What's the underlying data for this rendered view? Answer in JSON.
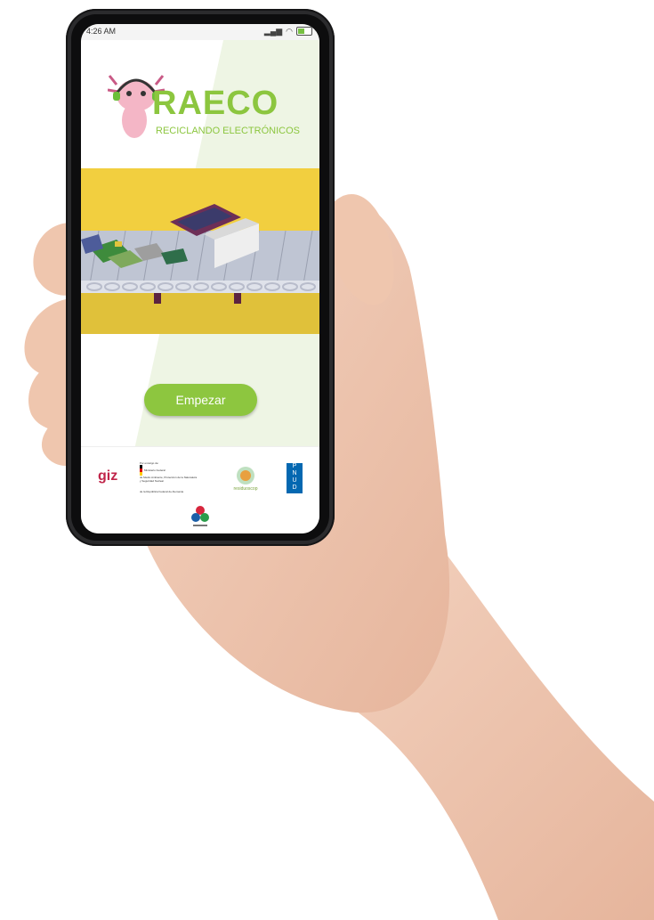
{
  "status_bar": {
    "time": "4:26 AM",
    "battery_level": 0.5
  },
  "app": {
    "brand_name": "RAECO",
    "tagline": "RECICLANDO ELECTRÓNICOS",
    "start_button_label": "Empezar"
  },
  "footer": {
    "giz_logo": "giz",
    "government_lines": [
      "Por encargo de:",
      "Ministerio Federal",
      "de Medio Ambiente, Protección de la Naturaleza",
      "y Seguridad Nuclear",
      "de la República Federal de Alemania"
    ],
    "residuos_logo": "residuoscop",
    "undp_letters": [
      "P",
      "N",
      "U",
      "D"
    ]
  },
  "colors": {
    "brand_green": "#8cc63f",
    "banner_yellow": "#f2cf3f",
    "giz_red": "#c0254a",
    "undp_blue": "#0468b1"
  }
}
